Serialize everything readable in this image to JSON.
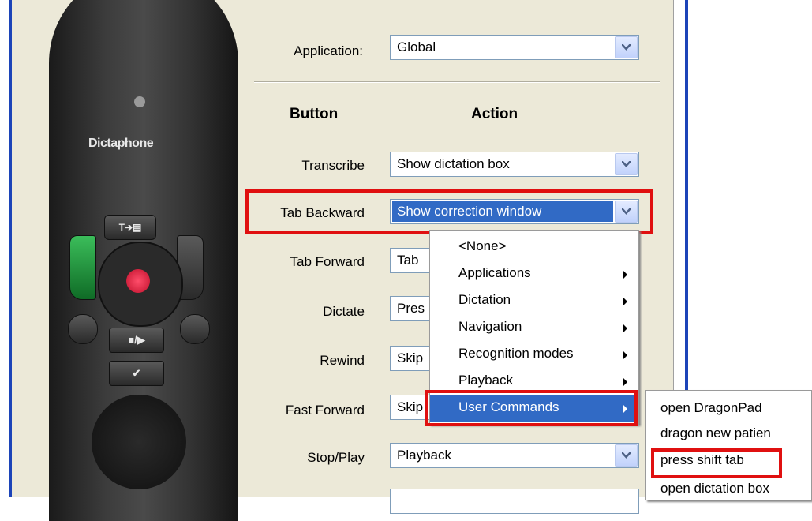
{
  "form": {
    "application_label": "Application:",
    "application_value": "Global",
    "button_header": "Button",
    "action_header": "Action",
    "rows": [
      {
        "button": "Transcribe",
        "action": "Show dictation box"
      },
      {
        "button": "Tab Backward",
        "action": "Show correction window"
      },
      {
        "button": "Tab Forward",
        "action": "Tab"
      },
      {
        "button": "Dictate",
        "action": "Pres"
      },
      {
        "button": "Rewind",
        "action": "Skip"
      },
      {
        "button": "Fast Forward",
        "action": "Skip"
      },
      {
        "button": "Stop/Play",
        "action": "Playback"
      }
    ]
  },
  "remote": {
    "brand": "Dictaphone",
    "key_transcribe": "T➔▤",
    "key_stopplay": "■/▶",
    "key_check": "✔"
  },
  "action_menu": {
    "items": [
      {
        "label": "<None>",
        "submenu": false
      },
      {
        "label": "Applications",
        "submenu": true
      },
      {
        "label": "Dictation",
        "submenu": true
      },
      {
        "label": "Navigation",
        "submenu": true
      },
      {
        "label": "Recognition modes",
        "submenu": true
      },
      {
        "label": "Playback",
        "submenu": true
      },
      {
        "label": "User Commands",
        "submenu": true
      }
    ],
    "selected_index": 6
  },
  "user_commands_menu": {
    "items": [
      "open DragonPad",
      "dragon new patien",
      "press shift tab",
      "open dictation box"
    ]
  },
  "colors": {
    "selection": "#316ac5",
    "highlight_outline": "#e01010",
    "window_frame": "#1c44b8"
  }
}
